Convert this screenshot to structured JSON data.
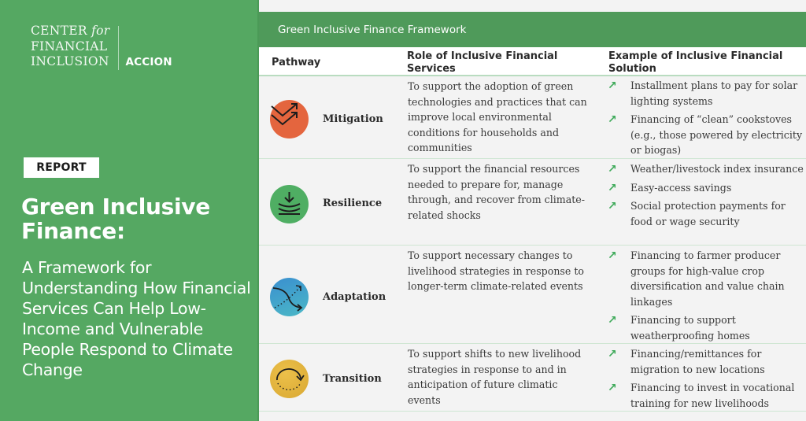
{
  "left_panel": {
    "logo": {
      "line1_center": "CENTER",
      "line1_for": "for",
      "line2": "FINANCIAL",
      "line3": "INCLUSION",
      "partner": "ACCION"
    },
    "badge": "REPORT",
    "title": "Green Inclusive Finance:",
    "subtitle": "A Framework for Understanding How Financial Services Can Help Low-Income and Vulnerable People Respond to Climate Change",
    "colors": {
      "background": "#55a862",
      "text": "#ffffff"
    }
  },
  "framework": {
    "title": "Green Inclusive Finance Framework",
    "columns": [
      "Pathway",
      "Role of Inclusive Financial Services",
      "Example of Inclusive Financial Solution"
    ],
    "rows": [
      {
        "pathway": "Mitigation",
        "icon": "chevrons-up-right-icon",
        "icon_color": "#e4653e",
        "role": "To support the adoption of green technologies and practices that can improve local environmental conditions for households and communities",
        "examples": [
          "Installment plans to pay for solar lighting systems",
          "Financing of “clean” cookstoves (e.g., those powered by electricity or biogas)"
        ]
      },
      {
        "pathway": "Resilience",
        "icon": "wave-down-arrow-icon",
        "icon_color": "#4fae63",
        "role": "To support the financial resources needed to prepare for, manage through, and recover from climate-related shocks",
        "examples": [
          "Weather/livestock index insurance",
          "Easy-access savings",
          "Social protection payments for food or wage security"
        ]
      },
      {
        "pathway": "Adaptation",
        "icon": "crossing-arrows-icon",
        "icon_color": "#3aa3c8",
        "role": "To support necessary changes to livelihood strategies in response to longer-term climate-related events",
        "examples": [
          "Financing to farmer producer groups for high-value crop diversification and value chain linkages",
          "Financing to support weatherproofing homes"
        ]
      },
      {
        "pathway": "Transition",
        "icon": "cycle-arrow-icon",
        "icon_color": "#e2b23a",
        "role": "To support shifts to new livelihood strategies in response to and in anticipation of future climatic events",
        "examples": [
          "Financing/remittances for migration to new locations",
          "Financing to invest in vocational training for new livelihoods"
        ]
      }
    ],
    "bullet_icon": "↗",
    "colors": {
      "header_band": "#4f9a5a",
      "bullet": "#3faa5a"
    }
  }
}
